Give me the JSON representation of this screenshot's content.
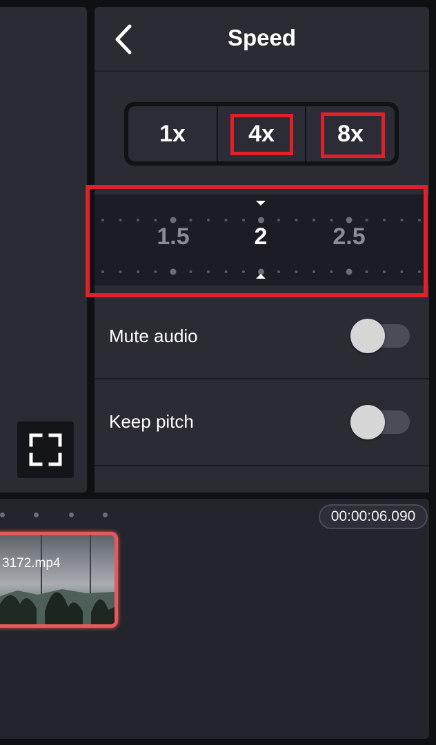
{
  "header": {
    "title": "Speed"
  },
  "presets": [
    {
      "label": "1x"
    },
    {
      "label": "4x"
    },
    {
      "label": "8x"
    }
  ],
  "ruler": {
    "labels": [
      "1.5",
      "2",
      "2.5"
    ],
    "current_value": "2"
  },
  "settings": [
    {
      "label": "Mute audio",
      "enabled": false
    },
    {
      "label": "Keep pitch",
      "enabled": false
    }
  ],
  "timeline": {
    "timecode": "00:00:06.090",
    "clip_name": "3172.mp4"
  },
  "colors": {
    "highlight": "#e0212a",
    "panel": "#2a2b33",
    "background": "#0f1014"
  },
  "icons": {
    "back": "chevron-left-icon",
    "fullscreen": "fullscreen-icon"
  }
}
